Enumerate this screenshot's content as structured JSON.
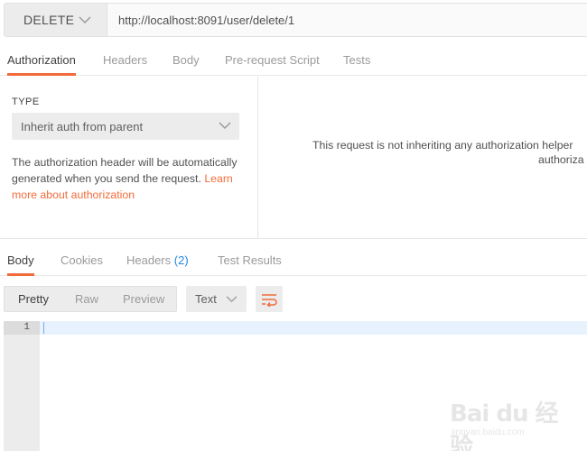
{
  "request": {
    "method": "DELETE",
    "url": "http://localhost:8091/user/delete/1"
  },
  "request_tabs": [
    {
      "label": "Authorization",
      "active": true
    },
    {
      "label": "Headers",
      "active": false
    },
    {
      "label": "Body",
      "active": false
    },
    {
      "label": "Pre-request Script",
      "active": false
    },
    {
      "label": "Tests",
      "active": false
    }
  ],
  "auth": {
    "type_label": "TYPE",
    "type_value": "Inherit auth from parent",
    "description": "The authorization header will be automatically generated when you send the request. ",
    "link_text": "Learn more about authorization",
    "message_line1": "This request is not inheriting any authorization helper",
    "message_line2": "authoriza"
  },
  "response_tabs": [
    {
      "label": "Body",
      "active": true
    },
    {
      "label": "Cookies",
      "active": false
    },
    {
      "label": "Headers",
      "count": "(2)",
      "active": false
    },
    {
      "label": "Test Results",
      "active": false
    }
  ],
  "response_view": {
    "modes": [
      "Pretty",
      "Raw",
      "Preview"
    ],
    "active_mode": "Pretty",
    "format": "Text"
  },
  "editor": {
    "line_numbers": [
      "1"
    ]
  },
  "watermark": {
    "main": "Bai du 经验",
    "sub": "jingyan.baidu.com"
  },
  "colors": {
    "accent": "#f26b3a",
    "count_blue": "#1e88e5"
  }
}
